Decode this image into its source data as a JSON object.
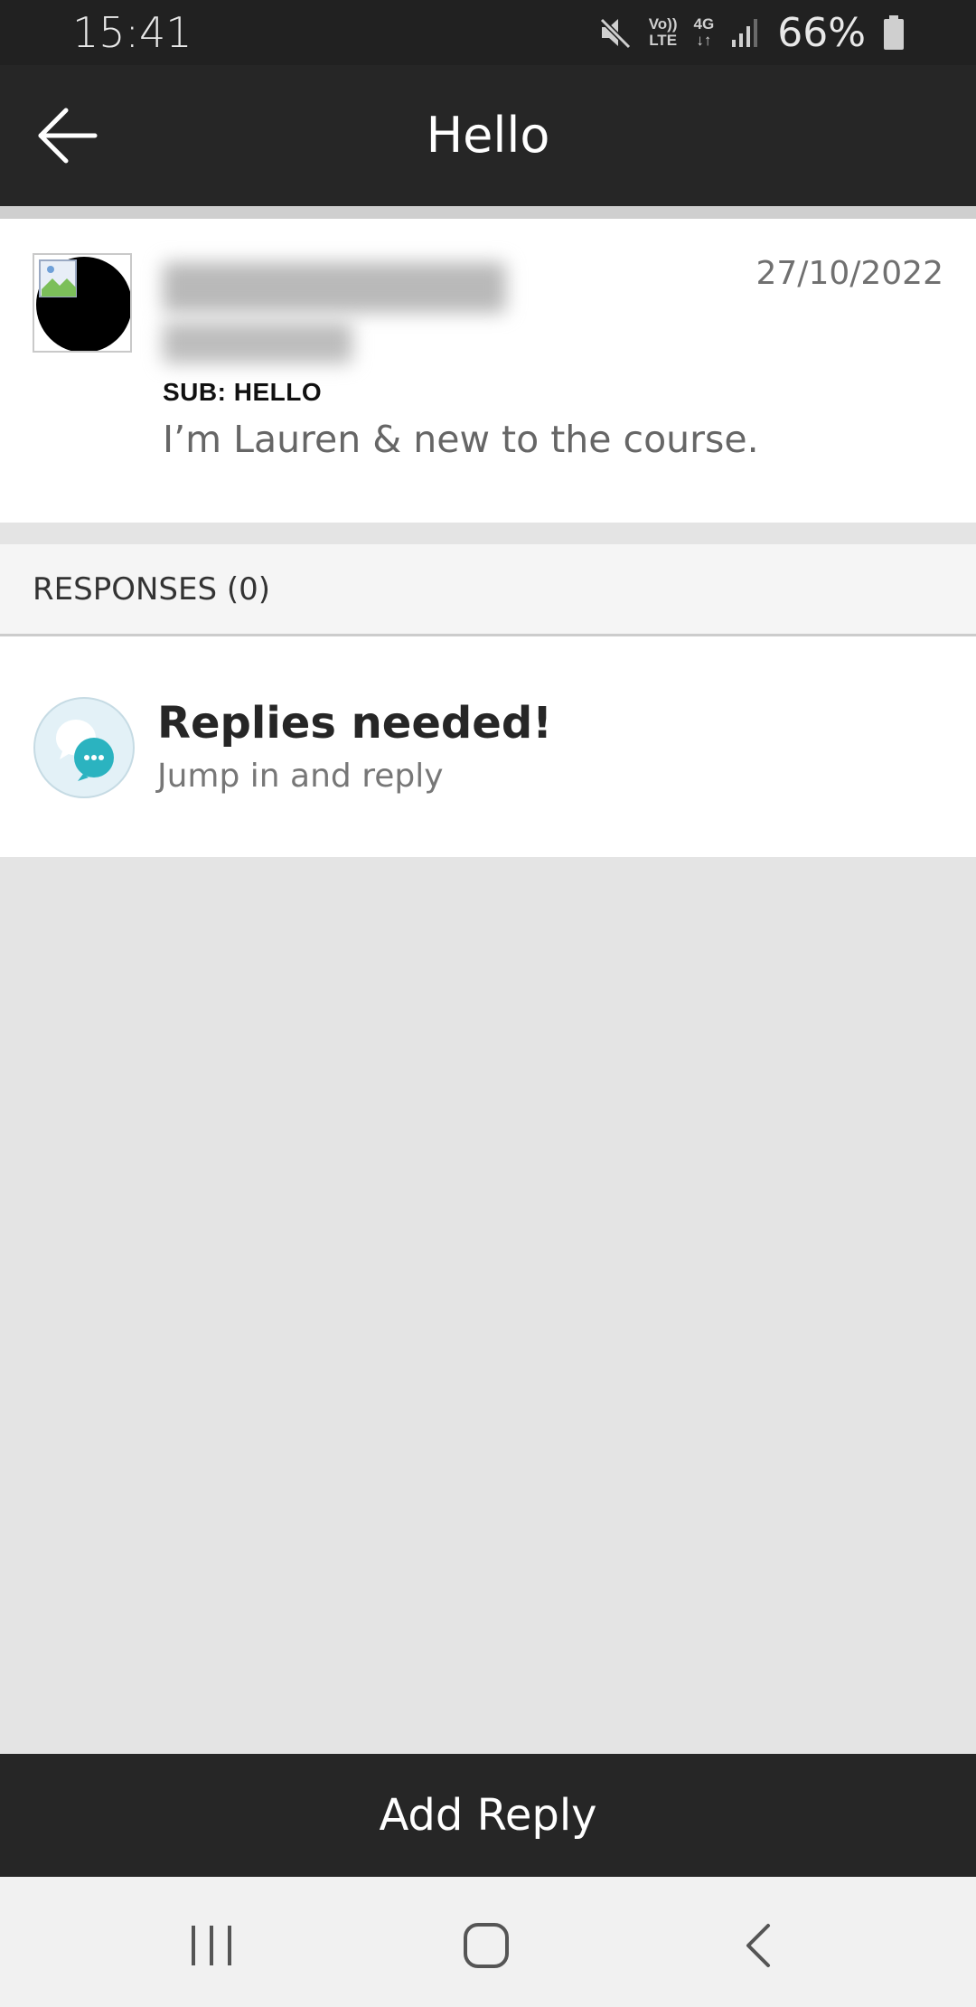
{
  "status_bar": {
    "time": "15:41",
    "network_top": "Vo))",
    "network_bottom": "LTE",
    "data_top": "4G",
    "data_bottom": "↓↑",
    "battery": "66%"
  },
  "app_bar": {
    "title": "Hello",
    "back_icon": "arrow-left-icon"
  },
  "post": {
    "date": "27/10/2022",
    "subject": "SUB: HELLO",
    "body": "I’m Lauren & new to the course."
  },
  "responses": {
    "label": "RESPONSES (0)"
  },
  "replies_prompt": {
    "title": "Replies needed!",
    "subtitle": "Jump in and reply",
    "icon": "chat-bubbles-icon"
  },
  "footer": {
    "add_reply_label": "Add Reply"
  },
  "colors": {
    "bar": "#262626",
    "accent": "#2bb3c0",
    "background": "#e4e4e4"
  }
}
